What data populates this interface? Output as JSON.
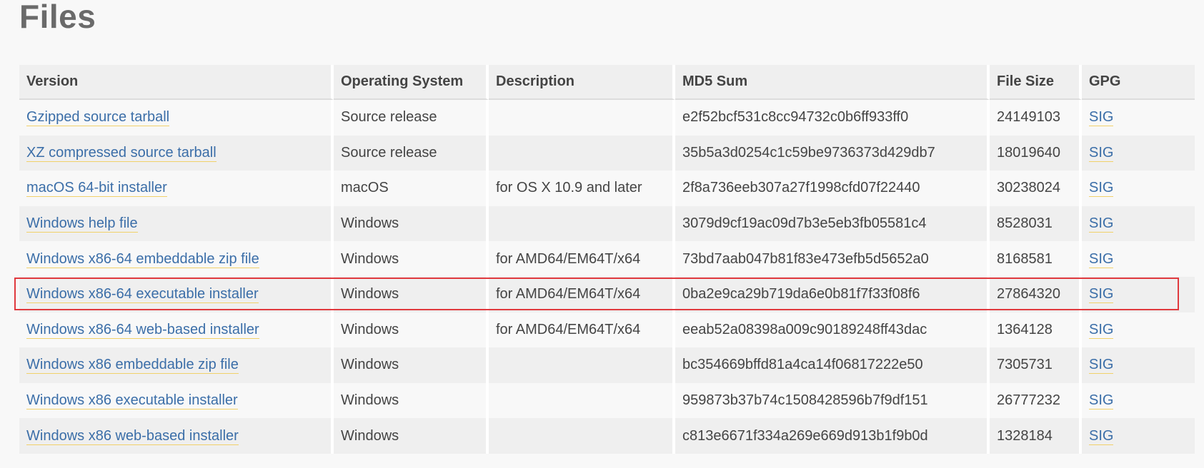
{
  "page": {
    "title": "Files"
  },
  "table": {
    "headers": [
      "Version",
      "Operating System",
      "Description",
      "MD5 Sum",
      "File Size",
      "GPG"
    ],
    "rows": [
      {
        "version": "Gzipped source tarball",
        "os": "Source release",
        "description": "",
        "md5": "e2f52bcf531c8cc94732c0b6ff933ff0",
        "size": "24149103",
        "gpg": "SIG"
      },
      {
        "version": "XZ compressed source tarball",
        "os": "Source release",
        "description": "",
        "md5": "35b5a3d0254c1c59be9736373d429db7",
        "size": "18019640",
        "gpg": "SIG"
      },
      {
        "version": "macOS 64-bit installer",
        "os": "macOS",
        "description": "for OS X 10.9 and later",
        "md5": "2f8a736eeb307a27f1998cfd07f22440",
        "size": "30238024",
        "gpg": "SIG"
      },
      {
        "version": "Windows help file",
        "os": "Windows",
        "description": "",
        "md5": "3079d9cf19ac09d7b3e5eb3fb05581c4",
        "size": "8528031",
        "gpg": "SIG"
      },
      {
        "version": "Windows x86-64 embeddable zip file",
        "os": "Windows",
        "description": "for AMD64/EM64T/x64",
        "md5": "73bd7aab047b81f83e473efb5d5652a0",
        "size": "8168581",
        "gpg": "SIG"
      },
      {
        "version": "Windows x86-64 executable installer",
        "os": "Windows",
        "description": "for AMD64/EM64T/x64",
        "md5": "0ba2e9ca29b719da6e0b81f7f33f08f6",
        "size": "27864320",
        "gpg": "SIG"
      },
      {
        "version": "Windows x86-64 web-based installer",
        "os": "Windows",
        "description": "for AMD64/EM64T/x64",
        "md5": "eeab52a08398a009c90189248ff43dac",
        "size": "1364128",
        "gpg": "SIG"
      },
      {
        "version": "Windows x86 embeddable zip file",
        "os": "Windows",
        "description": "",
        "md5": "bc354669bffd81a4ca14f06817222e50",
        "size": "7305731",
        "gpg": "SIG"
      },
      {
        "version": "Windows x86 executable installer",
        "os": "Windows",
        "description": "",
        "md5": "959873b37b74c1508428596b7f9df151",
        "size": "26777232",
        "gpg": "SIG"
      },
      {
        "version": "Windows x86 web-based installer",
        "os": "Windows",
        "description": "",
        "md5": "c813e6671f334a269e669d913b1f9b0d",
        "size": "1328184",
        "gpg": "SIG"
      }
    ]
  },
  "highlight": {
    "row_index": 5,
    "color": "#e0393e"
  },
  "colors": {
    "link": "#3b6ea8",
    "link_underline": "#f1d16a",
    "row_alt": "#efefef"
  }
}
